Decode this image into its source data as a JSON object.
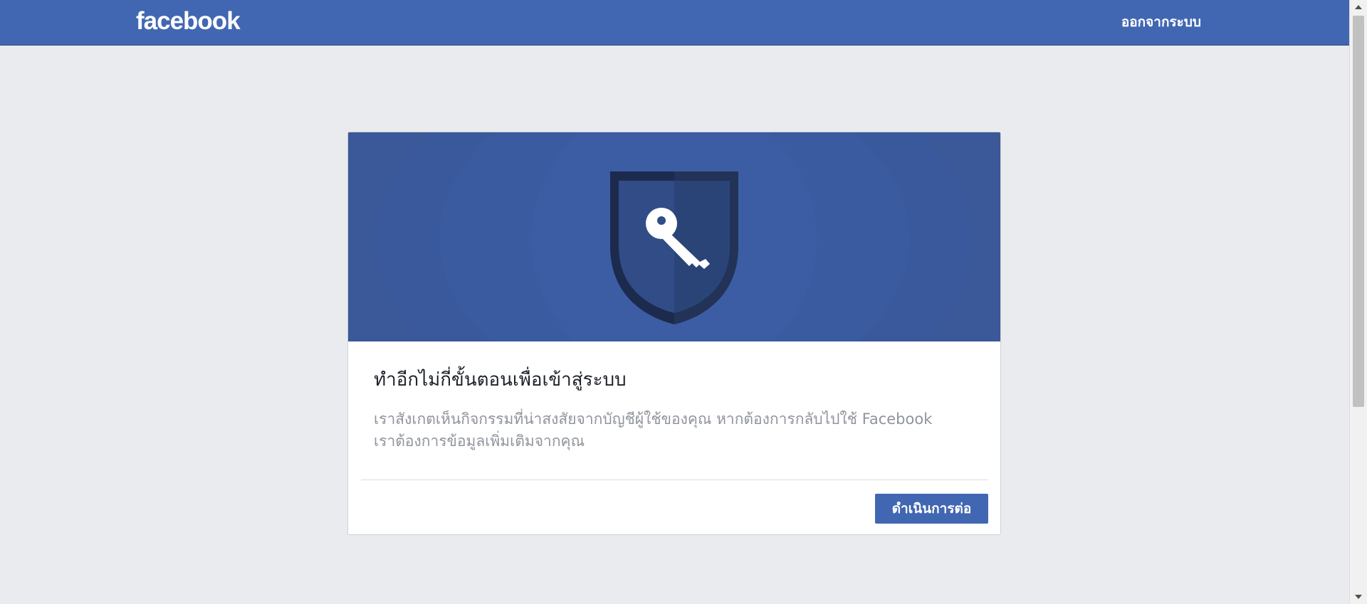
{
  "header": {
    "logo_text": "facebook",
    "logout_label": "ออกจากระบบ",
    "background_color": "#4267b2"
  },
  "card": {
    "hero_icon": "shield-key-icon",
    "hero_background_color": "#3b5998",
    "title": "ทำอีกไม่กี่ขั้นตอนเพื่อเข้าสู่ระบบ",
    "description": "เราสังเกตเห็นกิจกรรมที่น่าสงสัยจากบัญชีผู้ใช้ของคุณ หากต้องการกลับไปใช้ Facebook เราต้องการข้อมูลเพิ่มเติมจากคุณ",
    "continue_label": "ดำเนินการต่อ",
    "button_color": "#4267b2"
  },
  "page": {
    "background_color": "#e9ebee"
  }
}
